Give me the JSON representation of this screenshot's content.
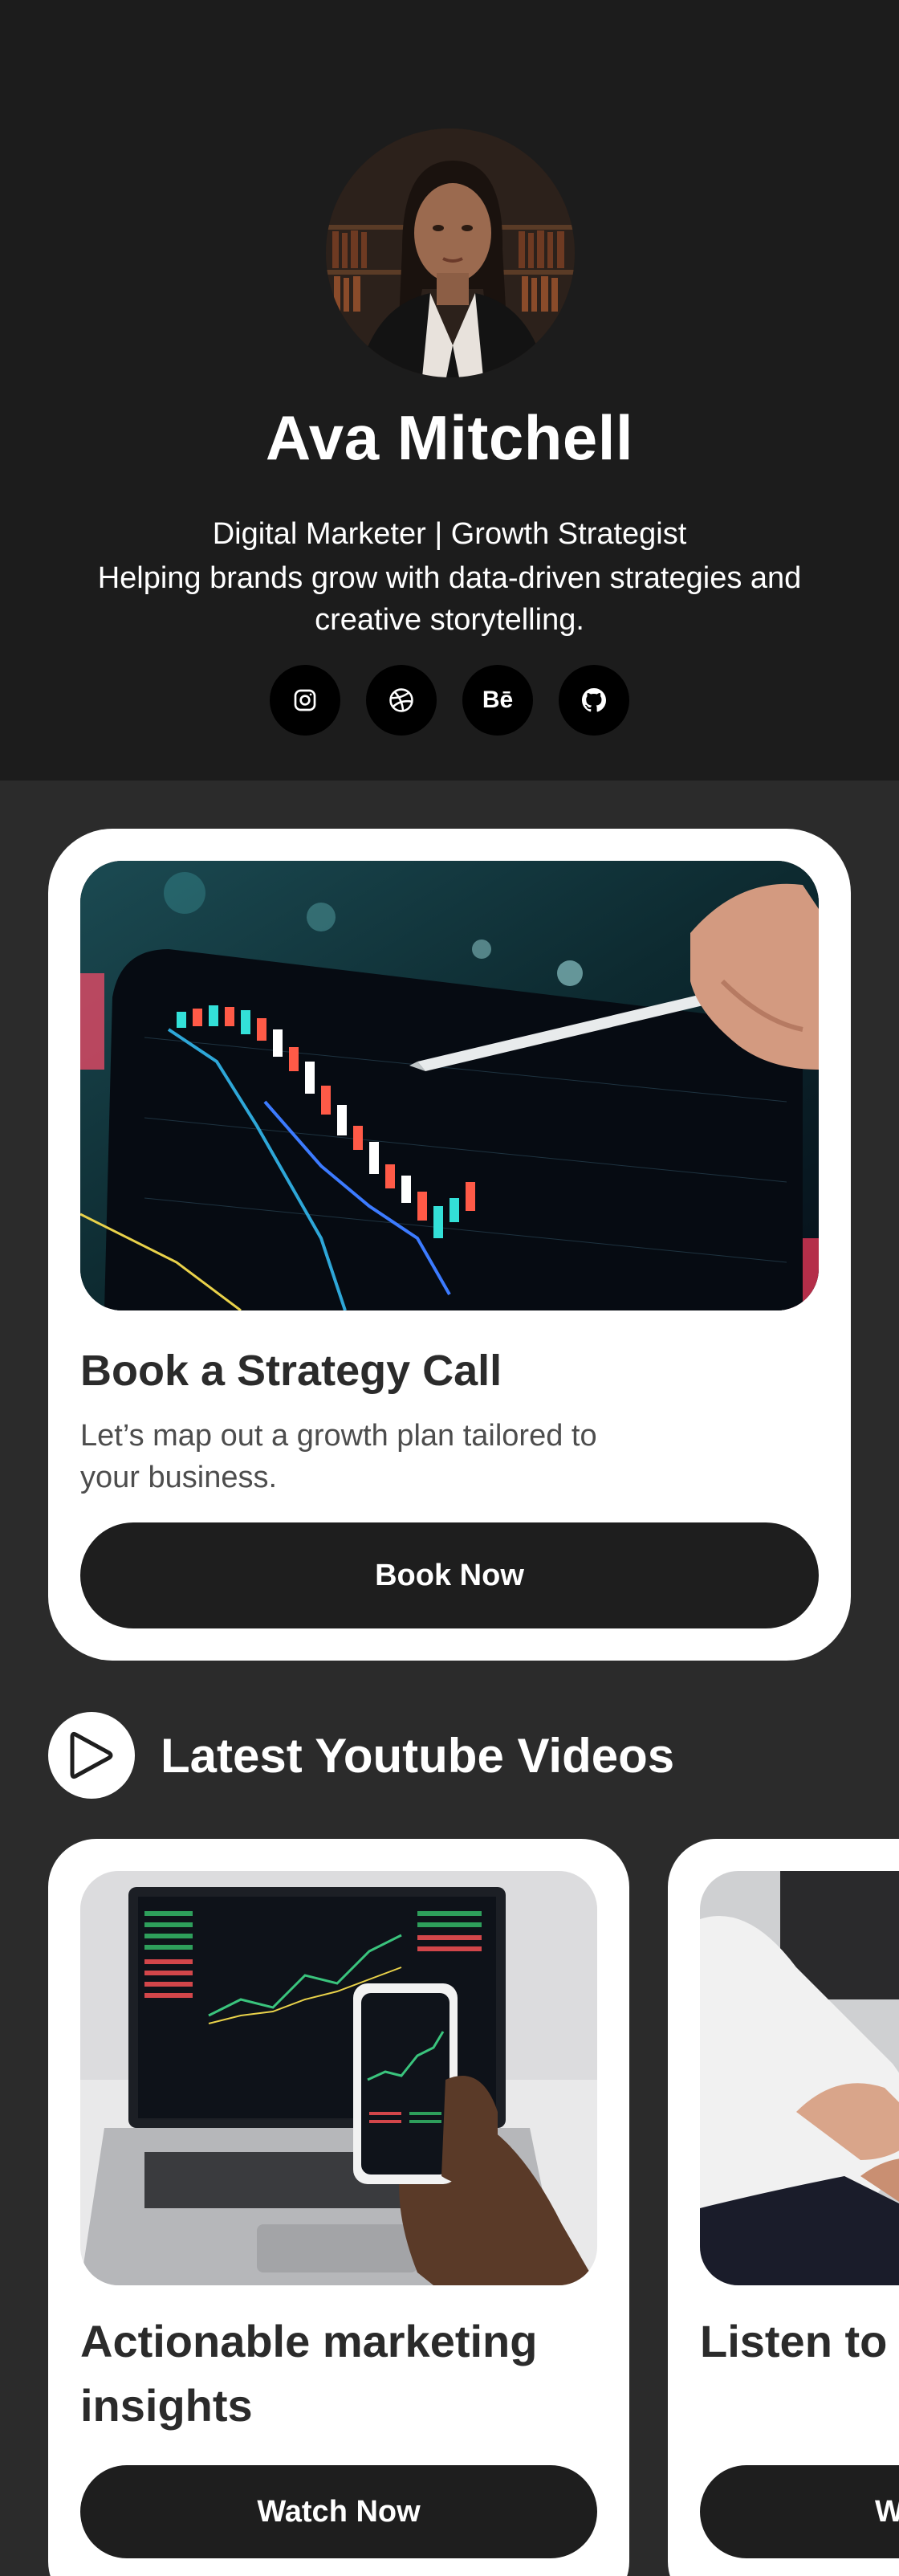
{
  "profile": {
    "name": "Ava Mitchell",
    "role": "Digital Marketer | Growth Strategist",
    "bio": "Helping brands grow with data-driven strategies and creative storytelling."
  },
  "socials": [
    {
      "icon": "instagram-icon"
    },
    {
      "icon": "dribbble-icon"
    },
    {
      "icon": "behance-icon",
      "label": "Bē"
    },
    {
      "icon": "github-icon"
    }
  ],
  "strategy_card": {
    "title": "Book a Strategy Call",
    "description": "Let’s map out a growth plan tailored to your business.",
    "button_label": "Book Now"
  },
  "videos_section": {
    "title": "Latest Youtube Videos",
    "icon": "play-icon",
    "cards": [
      {
        "title": "Actionable marketing insights",
        "button_label": "Watch Now"
      },
      {
        "title": "Listen to Podcast",
        "button_label": "W"
      }
    ]
  },
  "colors": {
    "header_bg": "#1c1c1c",
    "page_bg": "#2b2b2b",
    "card_bg": "#ffffff",
    "button_bg": "#1e1e1e"
  }
}
